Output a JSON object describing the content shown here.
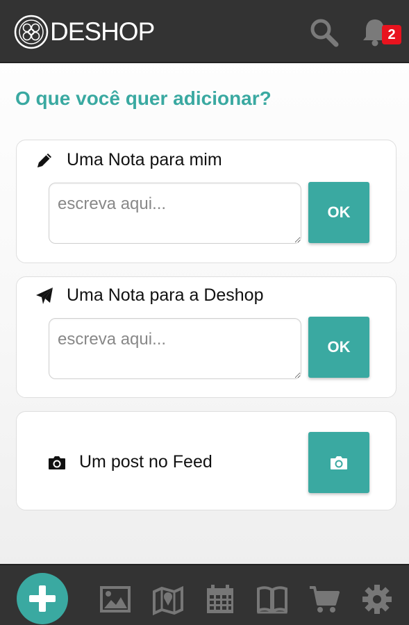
{
  "header": {
    "logo_text": "DESHOP",
    "notification_count": "2"
  },
  "page": {
    "title": "O que você quer adicionar?"
  },
  "cards": [
    {
      "label": "Uma Nota para mim",
      "icon": "pencil-icon",
      "input_placeholder": "escreva aqui...",
      "button_label": "OK"
    },
    {
      "label": "Uma Nota para a Deshop",
      "icon": "paper-plane-icon",
      "input_placeholder": "escreva aqui...",
      "button_label": "OK"
    },
    {
      "label": "Um post no Feed",
      "icon": "camera-icon",
      "button_icon": "camera-icon"
    }
  ],
  "bottom_nav": {
    "items": [
      "add-icon",
      "image-icon",
      "map-icon",
      "calendar-icon",
      "book-icon",
      "cart-icon",
      "gear-icon"
    ]
  },
  "colors": {
    "accent": "#3aa9a1",
    "header_bg": "#333333",
    "badge": "#e8131e",
    "nav_icon": "#777777"
  }
}
